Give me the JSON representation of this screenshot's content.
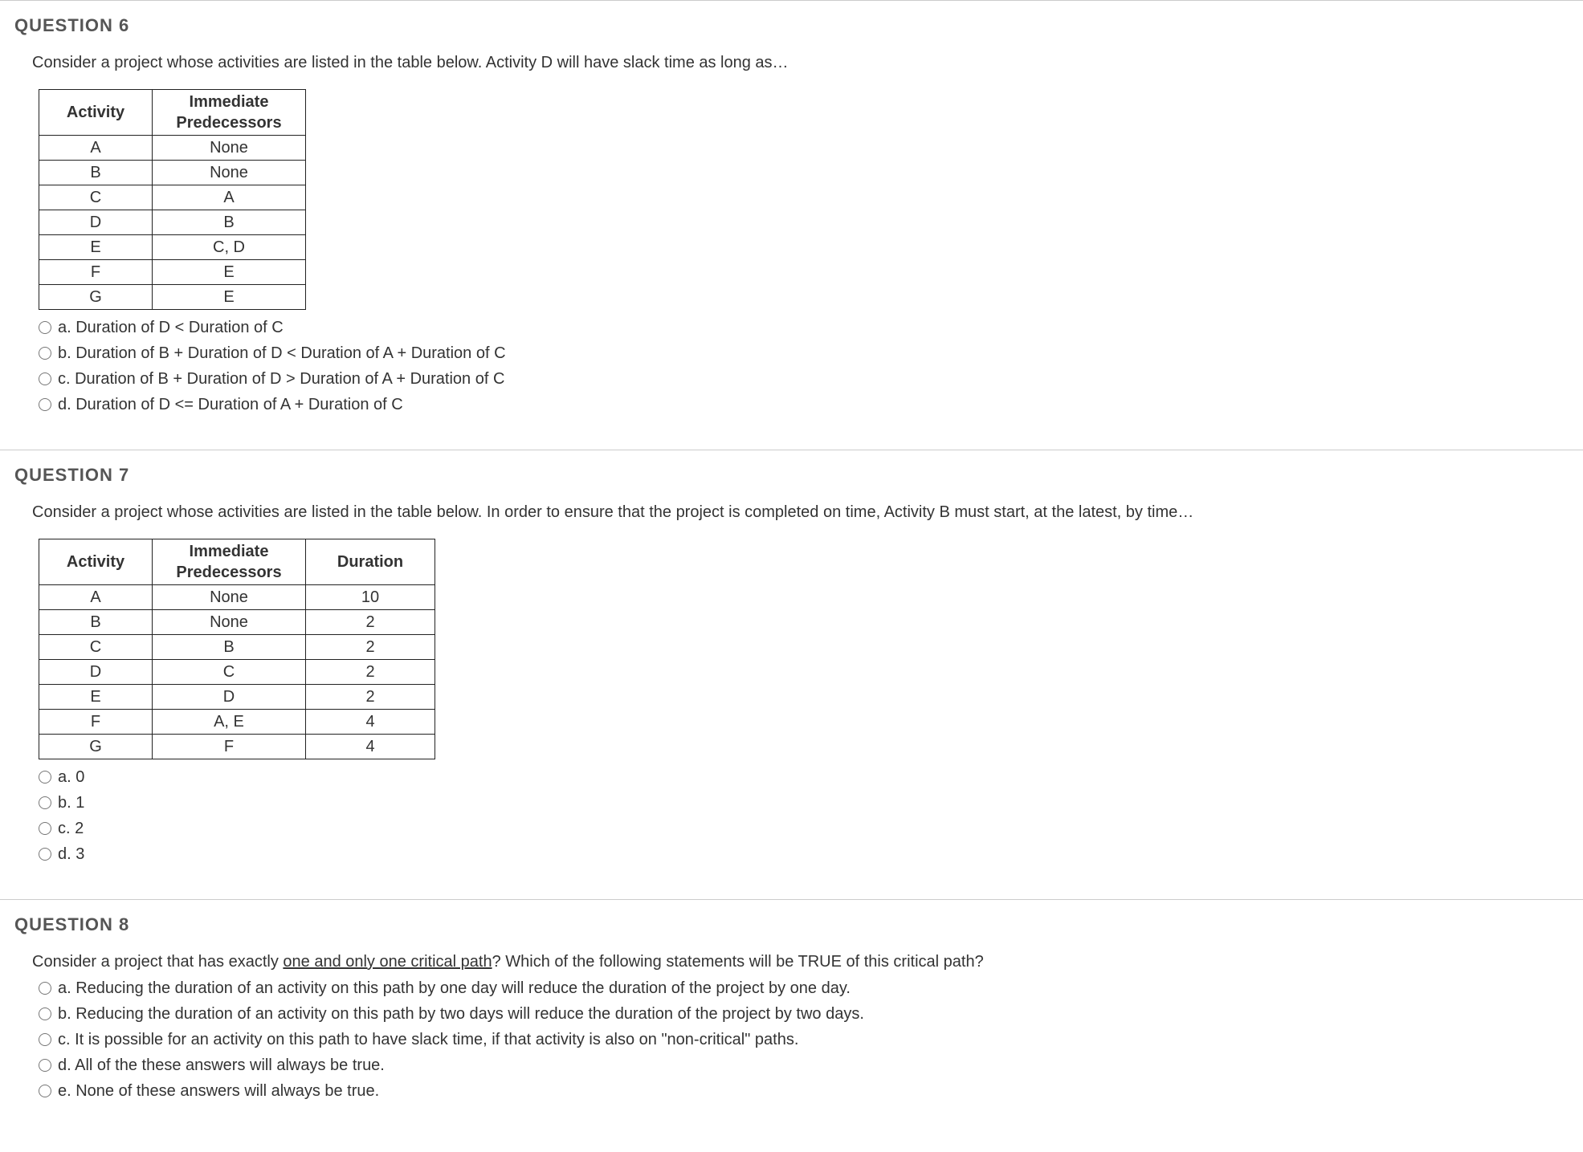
{
  "q6": {
    "title": "QUESTION 6",
    "prompt": "Consider a project whose activities are listed in the table below.  Activity D will have slack time as long as…",
    "headers": {
      "c1": "Activity",
      "c2": "Immediate Predecessors"
    },
    "rows": [
      {
        "act": "A",
        "pred": "None"
      },
      {
        "act": "B",
        "pred": "None"
      },
      {
        "act": "C",
        "pred": "A"
      },
      {
        "act": "D",
        "pred": "B"
      },
      {
        "act": "E",
        "pred": "C, D"
      },
      {
        "act": "F",
        "pred": "E"
      },
      {
        "act": "G",
        "pred": "E"
      }
    ],
    "options": {
      "a": "a. Duration of D < Duration of C",
      "b": "b. Duration of B + Duration of D < Duration of A + Duration of C",
      "c": "c. Duration of B + Duration of D > Duration of A + Duration of C",
      "d": "d. Duration of D <= Duration of A + Duration of C"
    }
  },
  "q7": {
    "title": "QUESTION 7",
    "prompt": "Consider a project whose activities are listed in the table below.  In order to ensure that the project is completed on time, Activity B must start, at the latest, by time…",
    "headers": {
      "c1": "Activity",
      "c2": "Immediate Predecessors",
      "c3": "Duration"
    },
    "rows": [
      {
        "act": "A",
        "pred": "None",
        "dur": "10"
      },
      {
        "act": "B",
        "pred": "None",
        "dur": "2"
      },
      {
        "act": "C",
        "pred": "B",
        "dur": "2"
      },
      {
        "act": "D",
        "pred": "C",
        "dur": "2"
      },
      {
        "act": "E",
        "pred": "D",
        "dur": "2"
      },
      {
        "act": "F",
        "pred": "A, E",
        "dur": "4"
      },
      {
        "act": "G",
        "pred": "F",
        "dur": "4"
      }
    ],
    "options": {
      "a": "a. 0",
      "b": "b. 1",
      "c": "c. 2",
      "d": "d. 3"
    }
  },
  "q8": {
    "title": "QUESTION 8",
    "prompt_pre": "Consider a project that has exactly ",
    "prompt_underline": "one and only one critical path",
    "prompt_post": "? Which of the following statements will be TRUE of this critical path?",
    "options": {
      "a": "a. Reducing the duration of an activity on this path by one day will reduce the duration of the project by one day.",
      "b": "b. Reducing the duration of an activity on this path by two days will reduce the duration of the project by two days.",
      "c": "c. It is possible for an activity on this path to have slack time, if that activity is also on \"non-critical\" paths.",
      "d": "d. All of the these answers will always be true.",
      "e": "e. None of these answers will always be true."
    }
  }
}
